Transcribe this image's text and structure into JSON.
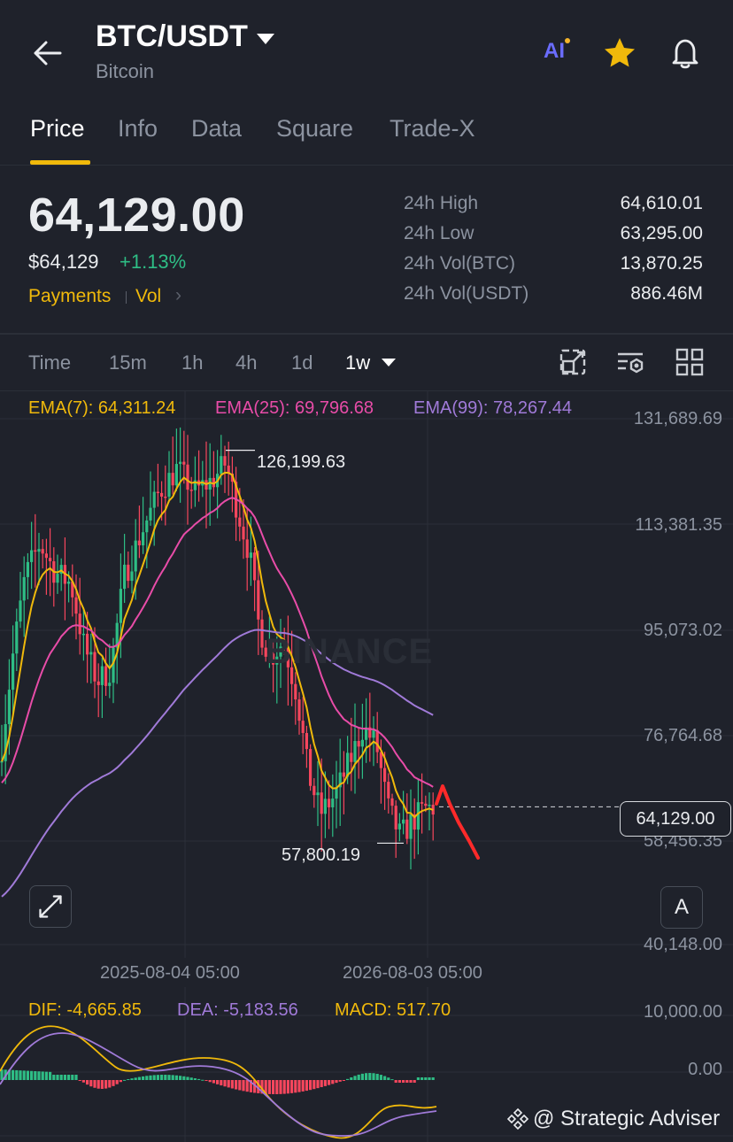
{
  "header": {
    "pair": "BTC/USDT",
    "asset_name": "Bitcoin",
    "ai_label": "AI",
    "icons": [
      "back-arrow-icon",
      "caret-down-icon",
      "ai-icon",
      "star-icon",
      "bell-icon"
    ]
  },
  "tabs": [
    {
      "label": "Price",
      "active": true
    },
    {
      "label": "Info",
      "active": false
    },
    {
      "label": "Data",
      "active": false
    },
    {
      "label": "Square",
      "active": false
    },
    {
      "label": "Trade-X",
      "active": false
    }
  ],
  "price": {
    "last": "64,129.00",
    "usd": "$64,129",
    "change": "+1.13%",
    "payments_label": "Payments",
    "vol_label": "Vol",
    "chevron": "›"
  },
  "stats": [
    {
      "label": "24h High",
      "value": "64,610.01"
    },
    {
      "label": "24h Low",
      "value": "63,295.00"
    },
    {
      "label": "24h Vol(BTC)",
      "value": "13,870.25"
    },
    {
      "label": "24h Vol(USDT)",
      "value": "886.46M"
    }
  ],
  "intervals": [
    {
      "label": "Time",
      "active": false
    },
    {
      "label": "15m",
      "active": false
    },
    {
      "label": "1h",
      "active": false
    },
    {
      "label": "4h",
      "active": false
    },
    {
      "label": "1d",
      "active": false
    },
    {
      "label": "1w",
      "active": true
    }
  ],
  "toolbar_icons": [
    "screenshot-icon",
    "indicator-settings-icon",
    "layout-grid-icon"
  ],
  "chart": {
    "ema7": "EMA(7): 64,311.24",
    "ema25": "EMA(25): 69,796.68",
    "ema99": "EMA(99): 78,267.44",
    "y_ticks": [
      "131,689.69",
      "113,381.35",
      "95,073.02",
      "76,764.68",
      "58,456.35",
      "40,148.00"
    ],
    "x_ticks": [
      "2025-08-04 05:00",
      "2026-08-03 05:00"
    ],
    "high_marker": "126,199.63",
    "low_marker": "57,800.19",
    "last_price_tag": "64,129.00",
    "watermark": "BINANCE",
    "auto_label": "A",
    "colors": {
      "up": "#2ebd85",
      "down": "#f6465d",
      "ema7": "#f0b90b",
      "ema25": "#e84ca8",
      "ema99": "#a07ad8",
      "drawn": "#ff2a2a"
    }
  },
  "chart_data": {
    "type": "candlestick",
    "interval": "1w",
    "y_range": [
      40148.0,
      131689.69
    ],
    "x_ticks": [
      "2025-08-04 05:00",
      "2026-08-03 05:00"
    ],
    "high": 126199.63,
    "low": 57800.19,
    "last": 64129.0,
    "ema": [
      {
        "name": "EMA(7)",
        "value": 64311.24
      },
      {
        "name": "EMA(25)",
        "value": 69796.68
      },
      {
        "name": "EMA(99)",
        "value": 78267.44
      }
    ]
  },
  "macd": {
    "dif": "DIF: -4,665.85",
    "dea": "DEA: -5,183.56",
    "macd": "MACD: 517.70",
    "y_ticks": [
      "10,000.00",
      "0.00"
    ]
  },
  "credit": "@ Strategic Adviser"
}
